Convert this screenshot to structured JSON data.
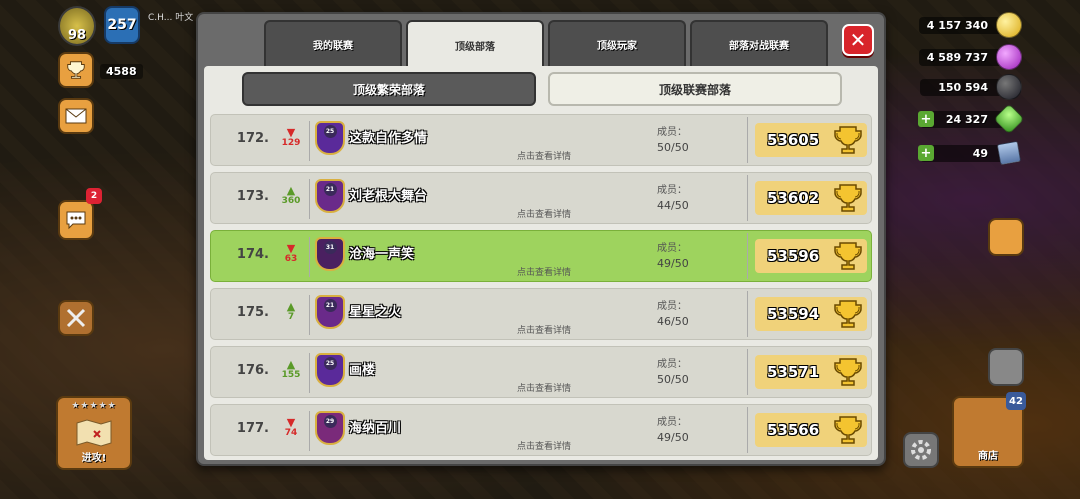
{
  "hud": {
    "level": "98",
    "town_hall": "257",
    "player_name": "C.H... 叶文",
    "trophies": "4588",
    "chat_count": "2",
    "attack_label": "进攻!",
    "attack_stars": "★★★★★",
    "shop_label": "商店",
    "shop_count": "42",
    "resources": {
      "gold": "4 157 340",
      "elixir": "4 589 737",
      "dark_elixir": "150 594",
      "gems": "24 327",
      "medals": "49"
    }
  },
  "tabs": [
    {
      "label": "我的联赛",
      "active": false
    },
    {
      "label": "顶级部落",
      "active": true
    },
    {
      "label": "顶级玩家",
      "active": false
    },
    {
      "label": "部落对战联赛",
      "active": false
    }
  ],
  "subtabs": [
    {
      "label": "顶级繁荣部落",
      "active": false
    },
    {
      "label": "顶级联赛部落",
      "active": true
    }
  ],
  "members_label": "成员：",
  "detail_label": "点击查看详情",
  "rows": [
    {
      "rank": "172.",
      "trend": "down",
      "change": "129",
      "badge_level": "25",
      "name": "这款自作多情",
      "members": "50/50",
      "score": "53605",
      "highlight": false
    },
    {
      "rank": "173.",
      "trend": "up",
      "change": "360",
      "badge_level": "21",
      "name": "刘老根大舞台",
      "members": "44/50",
      "score": "53602",
      "highlight": false
    },
    {
      "rank": "174.",
      "trend": "down",
      "change": "63",
      "badge_level": "31",
      "name": "沧海一声笑",
      "members": "49/50",
      "score": "53596",
      "highlight": true
    },
    {
      "rank": "175.",
      "trend": "up",
      "change": "7",
      "badge_level": "21",
      "name": "星星之火",
      "members": "46/50",
      "score": "53594",
      "highlight": false
    },
    {
      "rank": "176.",
      "trend": "up",
      "change": "155",
      "badge_level": "25",
      "name": "画楼",
      "members": "50/50",
      "score": "53571",
      "highlight": false
    },
    {
      "rank": "177.",
      "trend": "down",
      "change": "74",
      "badge_level": "29",
      "name": "海纳百川",
      "members": "49/50",
      "score": "53566",
      "highlight": false
    }
  ],
  "colors": {
    "highlight_row": "#9ed35e",
    "row": "#d8d8cf",
    "trend_down": "#d62a2a",
    "trend_up": "#5a9a28",
    "close_button": "#d8242a",
    "score_bg": "#f0d27a"
  }
}
